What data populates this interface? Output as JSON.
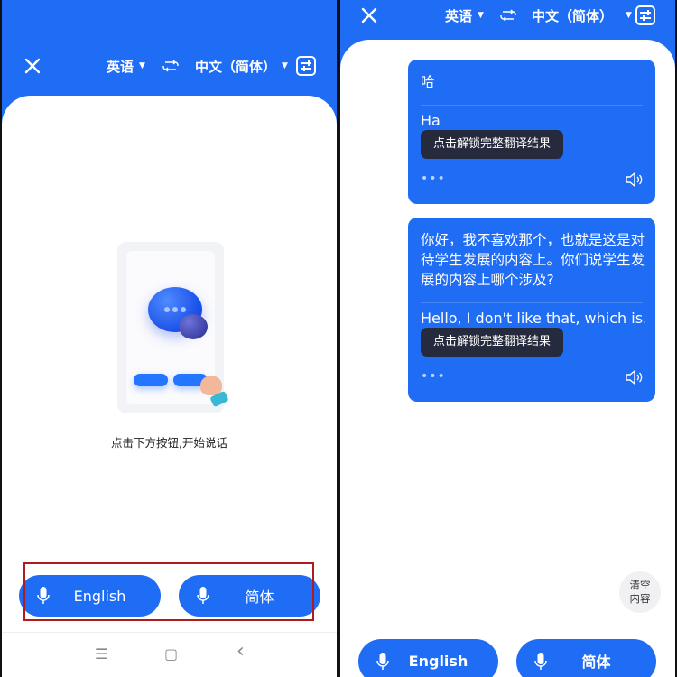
{
  "colors": {
    "brand_blue": "#1f6cf5",
    "unlock_bg": "#262a3d",
    "highlight_red": "#b01c1c"
  },
  "header": {
    "source_language": "英语",
    "target_language": "中文（简体）",
    "icons": {
      "close": "close-icon",
      "swap": "swap-icon",
      "settings": "sliders-icon",
      "caret": "caret-down-icon"
    }
  },
  "screen1": {
    "hint": "点击下方按钮,开始说话",
    "buttons": [
      {
        "label": "English",
        "icon": "microphone-icon"
      },
      {
        "label": "简体",
        "icon": "microphone-icon"
      }
    ],
    "navbar": {
      "menu": "☰",
      "home": "▢",
      "back": "‹"
    }
  },
  "screen2": {
    "messages": [
      {
        "source": "哈",
        "translation": "Ha",
        "unlock": "点击解锁完整翻译结果",
        "more": "•••"
      },
      {
        "source": "你好，我不喜欢那个，也就是这是对待学生发展的内容上。你们说学生发展的内容上哪个涉及?",
        "translation": "Hello, I don't like that, which is...",
        "unlock": "点击解锁完整翻译结果",
        "more": "•••"
      }
    ],
    "clear_button": "清空内容",
    "buttons": [
      {
        "label": "English",
        "icon": "microphone-icon"
      },
      {
        "label": "简体",
        "icon": "microphone-icon"
      }
    ]
  }
}
